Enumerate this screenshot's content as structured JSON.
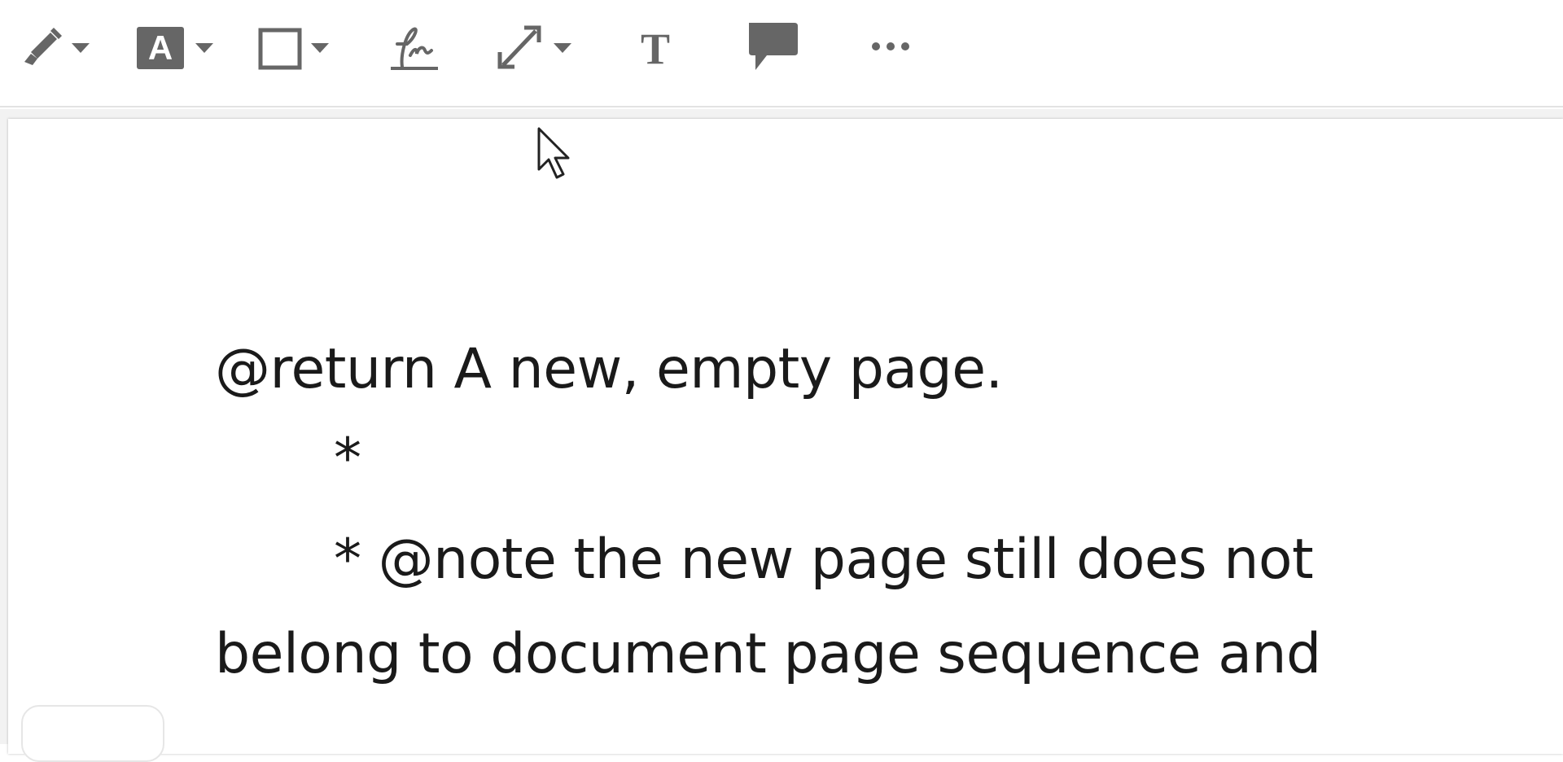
{
  "toolbar": {
    "tools": [
      {
        "name": "highlight-tool",
        "icon": "highlighter-icon",
        "has_dropdown": true
      },
      {
        "name": "text-color-tool",
        "icon": "text-box-icon",
        "has_dropdown": true
      },
      {
        "name": "shape-tool",
        "icon": "rectangle-icon",
        "has_dropdown": true
      },
      {
        "name": "sign-tool",
        "icon": "signature-icon",
        "has_dropdown": false
      },
      {
        "name": "resize-tool",
        "icon": "arrow-diagonal-icon",
        "has_dropdown": true
      },
      {
        "name": "text-tool",
        "icon": "text-t-icon",
        "has_dropdown": false
      },
      {
        "name": "comment-tool",
        "icon": "comment-bubble-icon",
        "has_dropdown": false
      },
      {
        "name": "more-tool",
        "icon": "more-dots-icon",
        "has_dropdown": false
      }
    ],
    "icon_color": "#666666"
  },
  "document": {
    "lines": [
      "@return A new, empty page.",
      "*",
      "* @note the new page still does not",
      "belong to document page sequence and"
    ]
  }
}
